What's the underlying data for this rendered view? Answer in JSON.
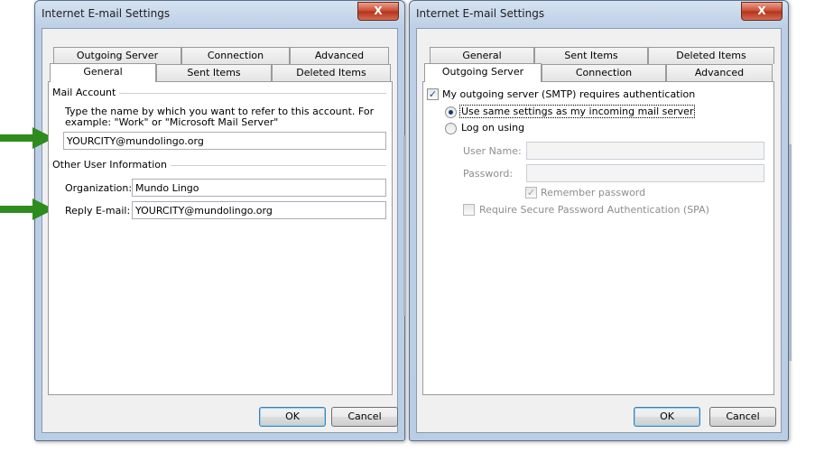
{
  "left_dialog": {
    "title": "Internet E-mail Settings",
    "close_glyph": "X",
    "tabs_back": [
      "Outgoing Server",
      "Connection",
      "Advanced"
    ],
    "tabs_front": [
      "General",
      "Sent Items",
      "Deleted Items"
    ],
    "active_tab": "General",
    "mail_account": {
      "group_label": "Mail Account",
      "description_1": "Type the name by which you want to refer to this account. For",
      "description_2": "example: \"Work\" or \"Microsoft Mail Server\"",
      "account_name": "YOURCITY@mundolingo.org"
    },
    "other_user_info": {
      "group_label": "Other User Information",
      "organization_label": "Organization:",
      "organization_value": "Mundo Lingo",
      "reply_email_label": "Reply E-mail:",
      "reply_email_value": "YOURCITY@mundolingo.org"
    },
    "ok_label": "OK",
    "cancel_label": "Cancel"
  },
  "right_dialog": {
    "title": "Internet E-mail Settings",
    "close_glyph": "X",
    "tabs_back": [
      "General",
      "Sent Items",
      "Deleted Items"
    ],
    "tabs_front": [
      "Outgoing Server",
      "Connection",
      "Advanced"
    ],
    "active_tab": "Outgoing Server",
    "requires_auth_label": "My outgoing server (SMTP) requires authentication",
    "requires_auth_checked": true,
    "use_same_settings_label": "Use same settings as my incoming mail server",
    "log_on_using_label": "Log on using",
    "user_name_label": "User Name:",
    "user_name_value": "",
    "password_label": "Password:",
    "password_value": "",
    "remember_password_label": "Remember password",
    "remember_password_checked": true,
    "spa_label": "Require Secure Password Authentication (SPA)",
    "spa_checked": false,
    "ok_label": "OK",
    "cancel_label": "Cancel"
  },
  "annotations": {
    "arrow_color": "#2e8b1e"
  },
  "colors": {
    "title_bar": "#bccfe6",
    "close_button": "#c7492f",
    "panel": "#ffffff",
    "dialog_bg": "#f0f0f0"
  }
}
